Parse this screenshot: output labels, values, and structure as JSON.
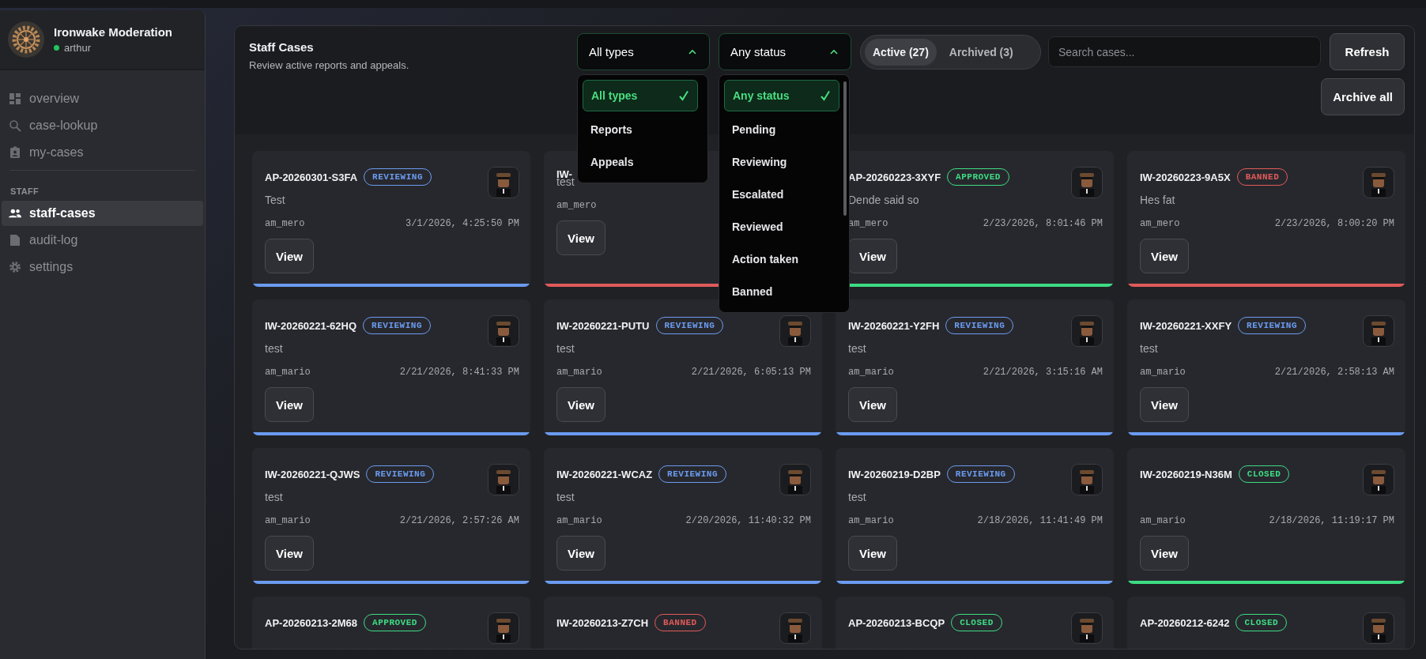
{
  "sidebar": {
    "brand": {
      "title": "Ironwake Moderation",
      "user": "arthur",
      "online": true
    },
    "nav": [
      {
        "label": "overview",
        "selected": false
      },
      {
        "label": "case-lookup",
        "selected": false
      },
      {
        "label": "my-cases",
        "selected": false
      }
    ],
    "section_label": "STAFF",
    "staff_nav": [
      {
        "label": "staff-cases",
        "selected": true
      },
      {
        "label": "audit-log",
        "selected": false
      },
      {
        "label": "settings",
        "selected": false
      }
    ]
  },
  "header": {
    "title": "Staff Cases",
    "subtitle": "Review active reports and appeals.",
    "filters": [
      {
        "value": "All types",
        "expanded": true,
        "options": [
          {
            "label": "All types",
            "selected": true
          },
          {
            "label": "Reports",
            "selected": false
          },
          {
            "label": "Appeals",
            "selected": false
          }
        ]
      },
      {
        "value": "Any status",
        "expanded": true,
        "options": [
          {
            "label": "Any status",
            "selected": true
          },
          {
            "label": "Pending",
            "selected": false
          },
          {
            "label": "Reviewing",
            "selected": false
          },
          {
            "label": "Escalated",
            "selected": false
          },
          {
            "label": "Reviewed",
            "selected": false
          },
          {
            "label": "Action taken",
            "selected": false
          },
          {
            "label": "Banned",
            "selected": false
          }
        ]
      }
    ],
    "tabs": [
      {
        "label": "Active (27)",
        "selected": true
      },
      {
        "label": "Archived (3)",
        "selected": false
      }
    ],
    "search": {
      "placeholder": "Search cases..."
    },
    "buttons": [
      "Refresh",
      "Archive all"
    ]
  },
  "cards": [
    {
      "id": "AP-20260301-S3FA",
      "status": "REVIEWING",
      "color": "#6b9bf0",
      "reason": "Test",
      "user": "am_mero",
      "date": "3/1/2026, 4:25:50 PM",
      "button": "View"
    },
    {
      "id": "IW-",
      "color": "#e05a5a",
      "reason": "test",
      "user": "am_mero",
      "button": "View"
    },
    {
      "id": "AP-20260223-3XYF",
      "status": "APPROVED",
      "color": "#3ddc84",
      "reason": "Dende said so",
      "user": "am_mero",
      "date": "2/23/2026, 8:01:46 PM",
      "button": "View"
    },
    {
      "id": "IW-20260223-9A5X",
      "status": "BANNED",
      "color": "#e05a5a",
      "reason": "Hes fat",
      "user": "am_mero",
      "date": "2/23/2026, 8:00:20 PM",
      "button": "View"
    },
    {
      "id": "IW-20260221-62HQ",
      "status": "REVIEWING",
      "color": "#6b9bf0",
      "reason": "test",
      "user": "am_mario",
      "date": "2/21/2026, 8:41:33 PM",
      "button": "View"
    },
    {
      "id": "IW-20260221-PUTU",
      "status": "REVIEWING",
      "color": "#6b9bf0",
      "reason": "test",
      "user": "am_mario",
      "date": "2/21/2026, 6:05:13 PM",
      "button": "View"
    },
    {
      "id": "IW-20260221-Y2FH",
      "status": "REVIEWING",
      "color": "#6b9bf0",
      "reason": "test",
      "user": "am_mario",
      "date": "2/21/2026, 3:15:16 AM",
      "button": "View"
    },
    {
      "id": "IW-20260221-XXFY",
      "status": "REVIEWING",
      "color": "#6b9bf0",
      "reason": "test",
      "user": "am_mario",
      "date": "2/21/2026, 2:58:13 AM",
      "button": "View"
    },
    {
      "id": "IW-20260221-QJWS",
      "status": "REVIEWING",
      "color": "#6b9bf0",
      "reason": "test",
      "user": "am_mario",
      "date": "2/21/2026, 2:57:26 AM",
      "button": "View"
    },
    {
      "id": "IW-20260221-WCAZ",
      "status": "REVIEWING",
      "color": "#6b9bf0",
      "reason": "test",
      "user": "am_mario",
      "date": "2/20/2026, 11:40:32 PM",
      "button": "View"
    },
    {
      "id": "IW-20260219-D2BP",
      "status": "REVIEWING",
      "color": "#6b9bf0",
      "reason": "test",
      "user": "am_mario",
      "date": "2/18/2026, 11:41:49 PM",
      "button": "View"
    },
    {
      "id": "IW-20260219-N36M",
      "status": "CLOSED",
      "color": "#3ddc84",
      "user": "am_mario",
      "date": "2/18/2026, 11:19:17 PM",
      "button": "View"
    },
    {
      "id": "AP-20260213-2M68",
      "status": "APPROVED",
      "color": "#3ddc84"
    },
    {
      "id": "IW-20260213-Z7CH",
      "status": "BANNED",
      "color": "#e05a5a"
    },
    {
      "id": "AP-20260213-BCQP",
      "status": "CLOSED",
      "color": "#3ddc84"
    },
    {
      "id": "AP-20260212-6242",
      "status": "CLOSED",
      "color": "#3ddc84"
    }
  ]
}
